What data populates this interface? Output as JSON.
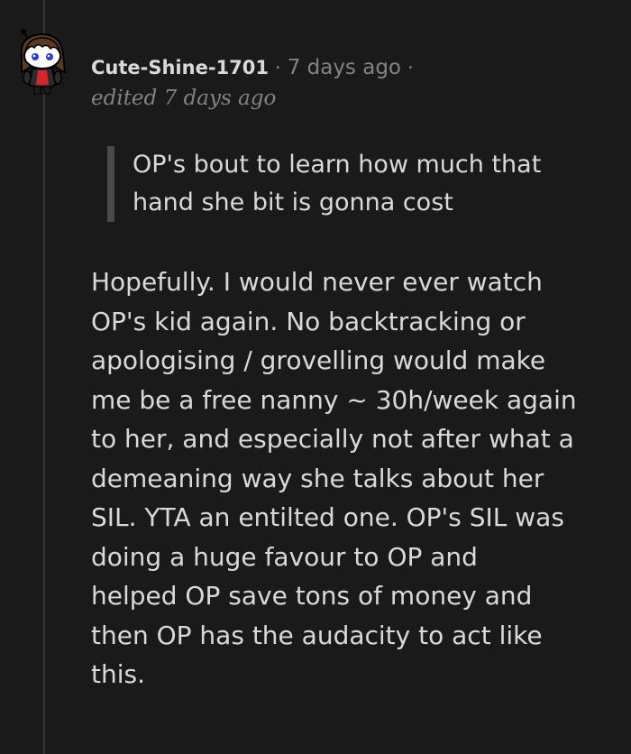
{
  "comment": {
    "author": "Cute-Shine-1701",
    "separator": "·",
    "timestamp": "7 days ago",
    "edited": "edited 7 days ago",
    "quote_lines": [
      "OP's bout to learn how much that",
      "hand she bit is gonna cost"
    ],
    "body_lines": [
      "Hopefully. I would never ever watch",
      "OP's kid again. No backtracking or",
      "apologising / grovelling would make",
      "me be a free nanny ~ 30h/week again",
      "to her, and especially not after what a",
      "demeaning way she talks about her",
      "SIL. YTA an entilted one. OP's SIL was",
      "doing a huge favour to OP and",
      "helped OP save tons of money and",
      "then OP has the audacity to act like",
      "this."
    ]
  },
  "colors": {
    "background": "#1a1a1b",
    "text": "#d7dadc",
    "meta": "#818384",
    "quote_bar": "#4a4a4b",
    "thread_line": "#343536"
  },
  "icons": {
    "avatar": "snoo-avatar-girl-brown-hair"
  }
}
